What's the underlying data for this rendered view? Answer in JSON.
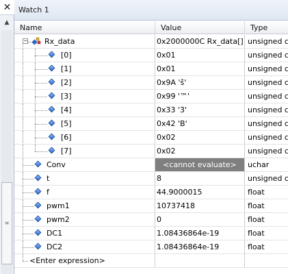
{
  "window": {
    "title": "Watch 1"
  },
  "left_pane": {
    "close_glyph": "✕",
    "grip_glyph": "≡"
  },
  "columns": {
    "name": "Name",
    "value": "Value",
    "type": "Type"
  },
  "rows": [
    {
      "name": "Rx_data",
      "value": "0x2000000C Rx_data[] ...",
      "type": "unsigned c"
    },
    {
      "name": "[0]",
      "value": "0x01",
      "type": "unsigned c"
    },
    {
      "name": "[1]",
      "value": "0x01",
      "type": "unsigned c"
    },
    {
      "name": "[2]",
      "value": "0x9A 'š'",
      "type": "unsigned c"
    },
    {
      "name": "[3]",
      "value": "0x99 '™'",
      "type": "unsigned c"
    },
    {
      "name": "[4]",
      "value": "0x33 '3'",
      "type": "unsigned c"
    },
    {
      "name": "[5]",
      "value": "0x42 'B'",
      "type": "unsigned c"
    },
    {
      "name": "[6]",
      "value": "0x02",
      "type": "unsigned c"
    },
    {
      "name": "[7]",
      "value": "0x02",
      "type": "unsigned c"
    },
    {
      "name": "Conv",
      "value": "<cannot evaluate>",
      "type": "uchar"
    },
    {
      "name": "t",
      "value": "8",
      "type": "unsigned c"
    },
    {
      "name": "f",
      "value": "44.9000015",
      "type": "float"
    },
    {
      "name": "pwm1",
      "value": "10737418",
      "type": "float"
    },
    {
      "name": "pwm2",
      "value": "0",
      "type": "float"
    },
    {
      "name": "DC1",
      "value": "1.08436864e-19",
      "type": "float"
    },
    {
      "name": "DC2",
      "value": "1.08436864e-19",
      "type": "float"
    }
  ],
  "enter_expression": "<Enter expression>",
  "expander_glyph": "−",
  "icons": {
    "variable": "blue-diamond-icon",
    "struct": "struct-variable-icon",
    "expander": "collapse-minus-icon"
  },
  "colors": {
    "cannot_evaluate_bg": "#7f7f7f",
    "variable_icon": "#1e5fc8"
  }
}
